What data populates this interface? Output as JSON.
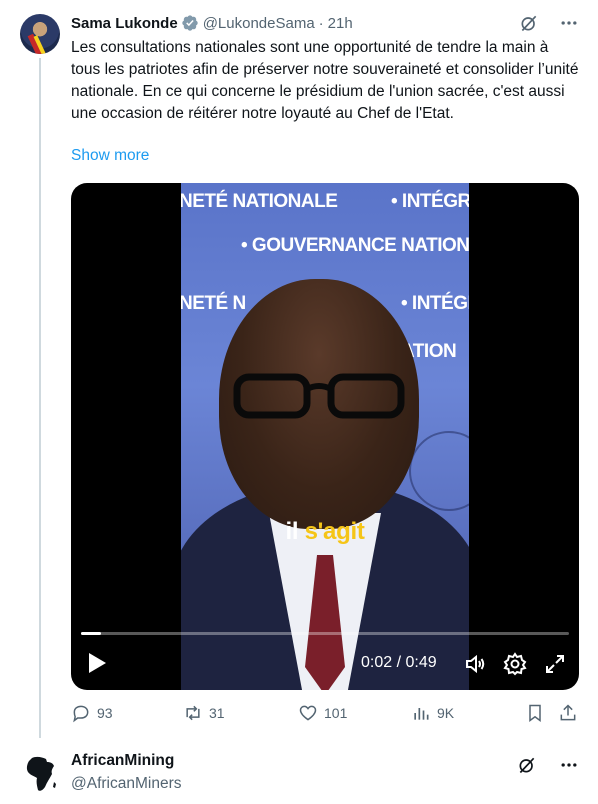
{
  "tweet": {
    "author_name": "Sama Lukonde",
    "handle": "@LukondeSama",
    "separator": "·",
    "time": "21h",
    "text": "Les consultations nationales sont une opportunité de tendre la main à tous les patriotes afin de préserver notre souveraineté et consolider l’unité nationale. En ce qui concerne le présidium de l'union sacrée, c'est aussi une occasion de réitérer notre loyauté au Chef de l'Etat.",
    "show_more": "Show more",
    "video": {
      "banner_texts": [
        "NETÉ NATIONALE",
        "• INTÉGR",
        "• GOUVERNANCE NATION",
        "NETÉ N",
        "• INTÉGR",
        "ATION"
      ],
      "caption_word1": "il",
      "caption_word2": "s'agit",
      "time_display": "0:02 / 0:49",
      "progress_fraction": 0.04
    },
    "actions": {
      "replies": "93",
      "reposts": "31",
      "likes": "101",
      "views": "9K"
    }
  },
  "next_tweet": {
    "author_name": "AfricanMining",
    "handle": "@AfricanMiners"
  },
  "colors": {
    "accent": "#1d9bf0",
    "secondary_text": "#536471",
    "caption_highlight": "#f5c518"
  },
  "icons": [
    "verified-badge-icon",
    "grok-icon",
    "more-icon",
    "play-icon",
    "volume-icon",
    "settings-icon",
    "fullscreen-icon",
    "reply-icon",
    "repost-icon",
    "like-icon",
    "views-icon",
    "bookmark-icon",
    "share-icon",
    "africa-map-icon"
  ]
}
